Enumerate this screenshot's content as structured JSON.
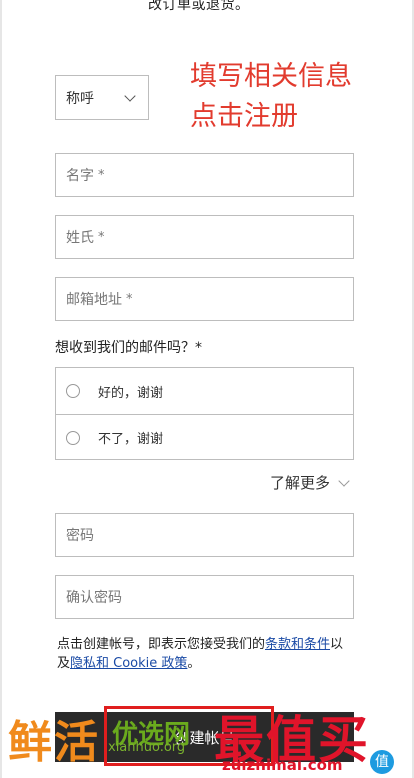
{
  "top_text": "改订单或退货。",
  "annotation": {
    "line1": "填写相关信息",
    "line2": "点击注册"
  },
  "salutation": {
    "value": "称呼"
  },
  "fields": {
    "first_name": {
      "placeholder": "名字",
      "required": "*"
    },
    "last_name": {
      "placeholder": "姓氏",
      "required": "*"
    },
    "email": {
      "placeholder": "邮箱地址",
      "required": "*"
    },
    "password": {
      "placeholder": "密码"
    },
    "confirm_password": {
      "placeholder": "确认密码"
    }
  },
  "newsletter": {
    "question": "想收到我们的邮件吗？*",
    "options": [
      "好的，谢谢",
      "不了，谢谢"
    ]
  },
  "learn_more": "了解更多",
  "terms": {
    "prefix": "点击创建帐号，即表示您接受我们的",
    "terms_link": "条款和条件",
    "middle": "以及",
    "privacy_link": "隐私和 Cookie 政策",
    "suffix": "。"
  },
  "create_button": "创建帐号",
  "watermarks": {
    "left_big": "鲜活",
    "left_green": "优选网",
    "left_sub": "xianhuo.org",
    "right_big": "最值买",
    "right_sub": "zuizhimai.com",
    "right_icon": "值"
  },
  "colors": {
    "annotation": "#e23b2e",
    "link": "#1a4aa5",
    "button": "#2a2a2a",
    "highlight": "#e01e1e"
  }
}
